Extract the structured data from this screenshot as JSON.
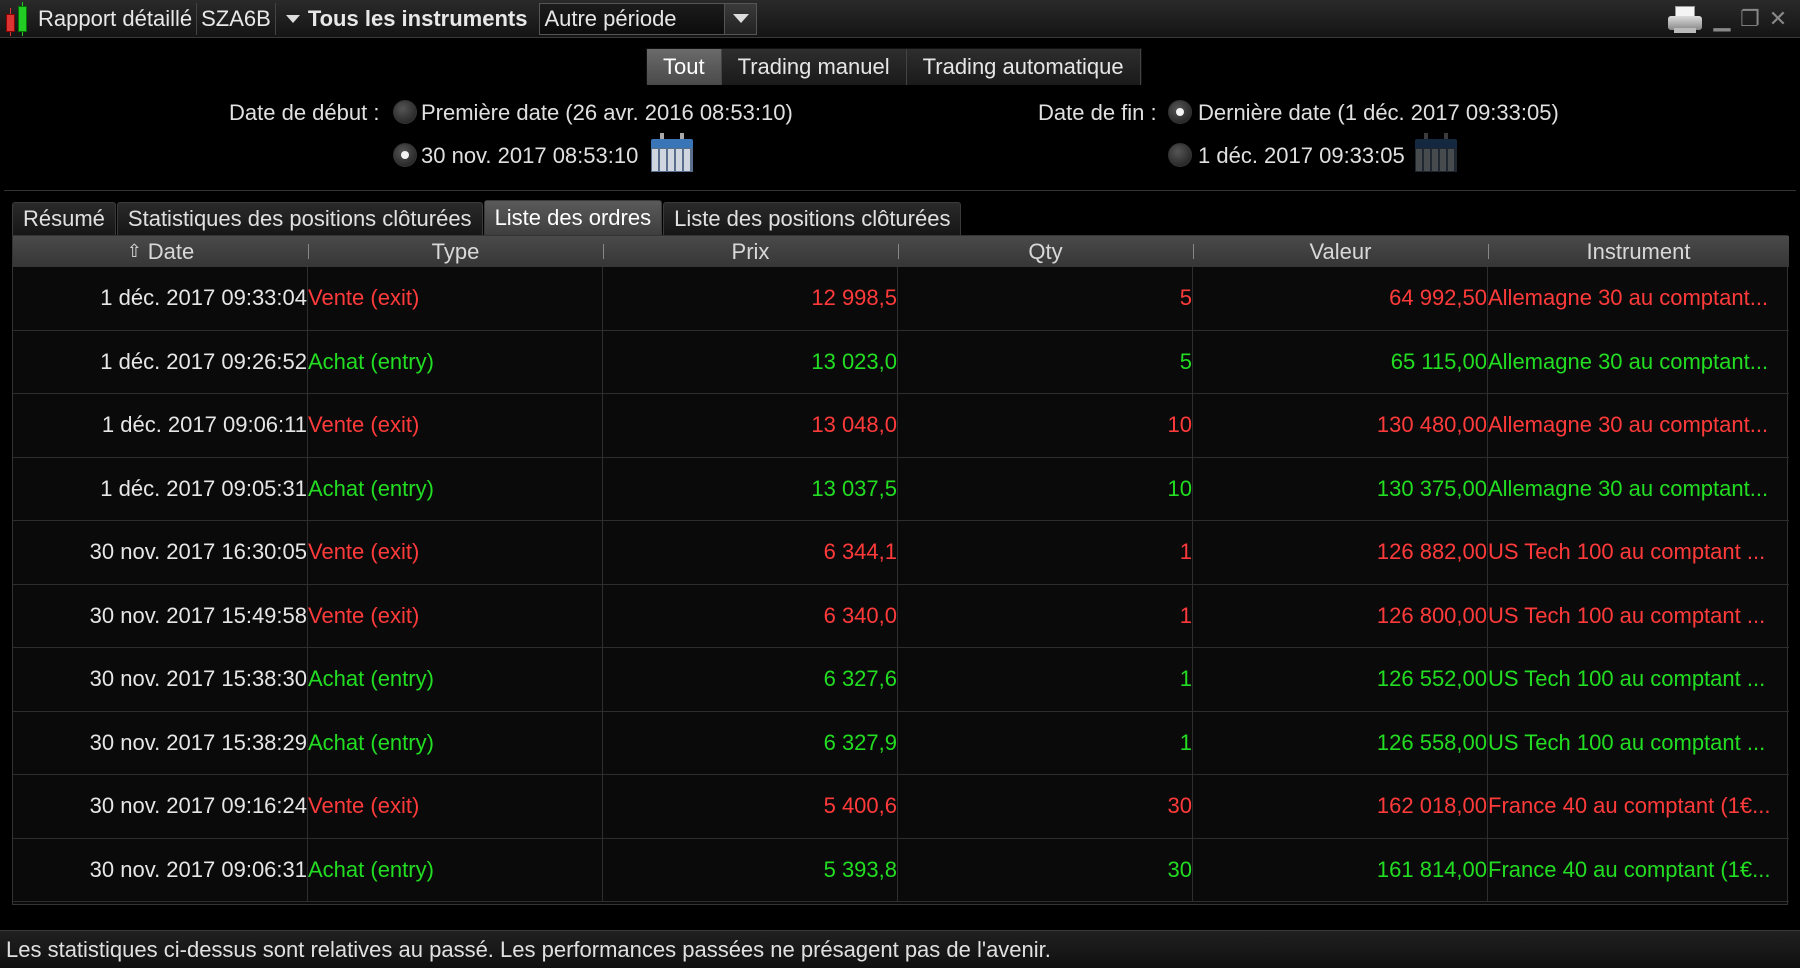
{
  "titlebar": {
    "title": "Rapport détaillé",
    "account": "SZA6B",
    "instruments": "Tous les instruments",
    "period": "Autre période"
  },
  "modes": [
    "Tout",
    "Trading manuel",
    "Trading automatique"
  ],
  "start": {
    "label": "Date de début :",
    "first_date": "Première date (26 avr. 2016 08:53:10)",
    "custom_date": "30 nov. 2017 08:53:10"
  },
  "end": {
    "label": "Date de fin :",
    "last_date": "Dernière date (1 déc. 2017 09:33:05)",
    "custom_date": "1 déc. 2017 09:33:05"
  },
  "tabs": [
    "Résumé",
    "Statistiques des positions clôturées",
    "Liste des ordres",
    "Liste des positions clôturées"
  ],
  "columns": [
    "Date",
    "Type",
    "Prix",
    "Qty",
    "Valeur",
    "Instrument"
  ],
  "colors": {
    "sell": "#ff3a3a",
    "buy": "#22dd22"
  },
  "rows": [
    {
      "date": "1 déc. 2017 09:33:04",
      "type": "Vente (exit)",
      "prix": "12 998,5",
      "qty": "5",
      "valeur": "64 992,50",
      "instrument": "Allemagne 30 au comptant...",
      "side": "sell"
    },
    {
      "date": "1 déc. 2017 09:26:52",
      "type": "Achat (entry)",
      "prix": "13 023,0",
      "qty": "5",
      "valeur": "65 115,00",
      "instrument": "Allemagne 30 au comptant...",
      "side": "buy"
    },
    {
      "date": "1 déc. 2017 09:06:11",
      "type": "Vente (exit)",
      "prix": "13 048,0",
      "qty": "10",
      "valeur": "130 480,00",
      "instrument": "Allemagne 30 au comptant...",
      "side": "sell"
    },
    {
      "date": "1 déc. 2017 09:05:31",
      "type": "Achat (entry)",
      "prix": "13 037,5",
      "qty": "10",
      "valeur": "130 375,00",
      "instrument": "Allemagne 30 au comptant...",
      "side": "buy"
    },
    {
      "date": "30 nov. 2017 16:30:05",
      "type": "Vente (exit)",
      "prix": "6 344,1",
      "qty": "1",
      "valeur": "126 882,00",
      "instrument": "US Tech 100 au comptant ...",
      "side": "sell"
    },
    {
      "date": "30 nov. 2017 15:49:58",
      "type": "Vente (exit)",
      "prix": "6 340,0",
      "qty": "1",
      "valeur": "126 800,00",
      "instrument": "US Tech 100 au comptant ...",
      "side": "sell"
    },
    {
      "date": "30 nov. 2017 15:38:30",
      "type": "Achat (entry)",
      "prix": "6 327,6",
      "qty": "1",
      "valeur": "126 552,00",
      "instrument": "US Tech 100 au comptant ...",
      "side": "buy"
    },
    {
      "date": "30 nov. 2017 15:38:29",
      "type": "Achat (entry)",
      "prix": "6 327,9",
      "qty": "1",
      "valeur": "126 558,00",
      "instrument": "US Tech 100 au comptant ...",
      "side": "buy"
    },
    {
      "date": "30 nov. 2017 09:16:24",
      "type": "Vente (exit)",
      "prix": "5 400,6",
      "qty": "30",
      "valeur": "162 018,00",
      "instrument": "France 40 au comptant (1€...",
      "side": "sell"
    },
    {
      "date": "30 nov. 2017 09:06:31",
      "type": "Achat (entry)",
      "prix": "5 393,8",
      "qty": "30",
      "valeur": "161 814,00",
      "instrument": "France 40 au comptant (1€...",
      "side": "buy"
    }
  ],
  "footer": "Les statistiques ci-dessus sont relatives au passé. Les performances passées ne présagent pas de l'avenir."
}
